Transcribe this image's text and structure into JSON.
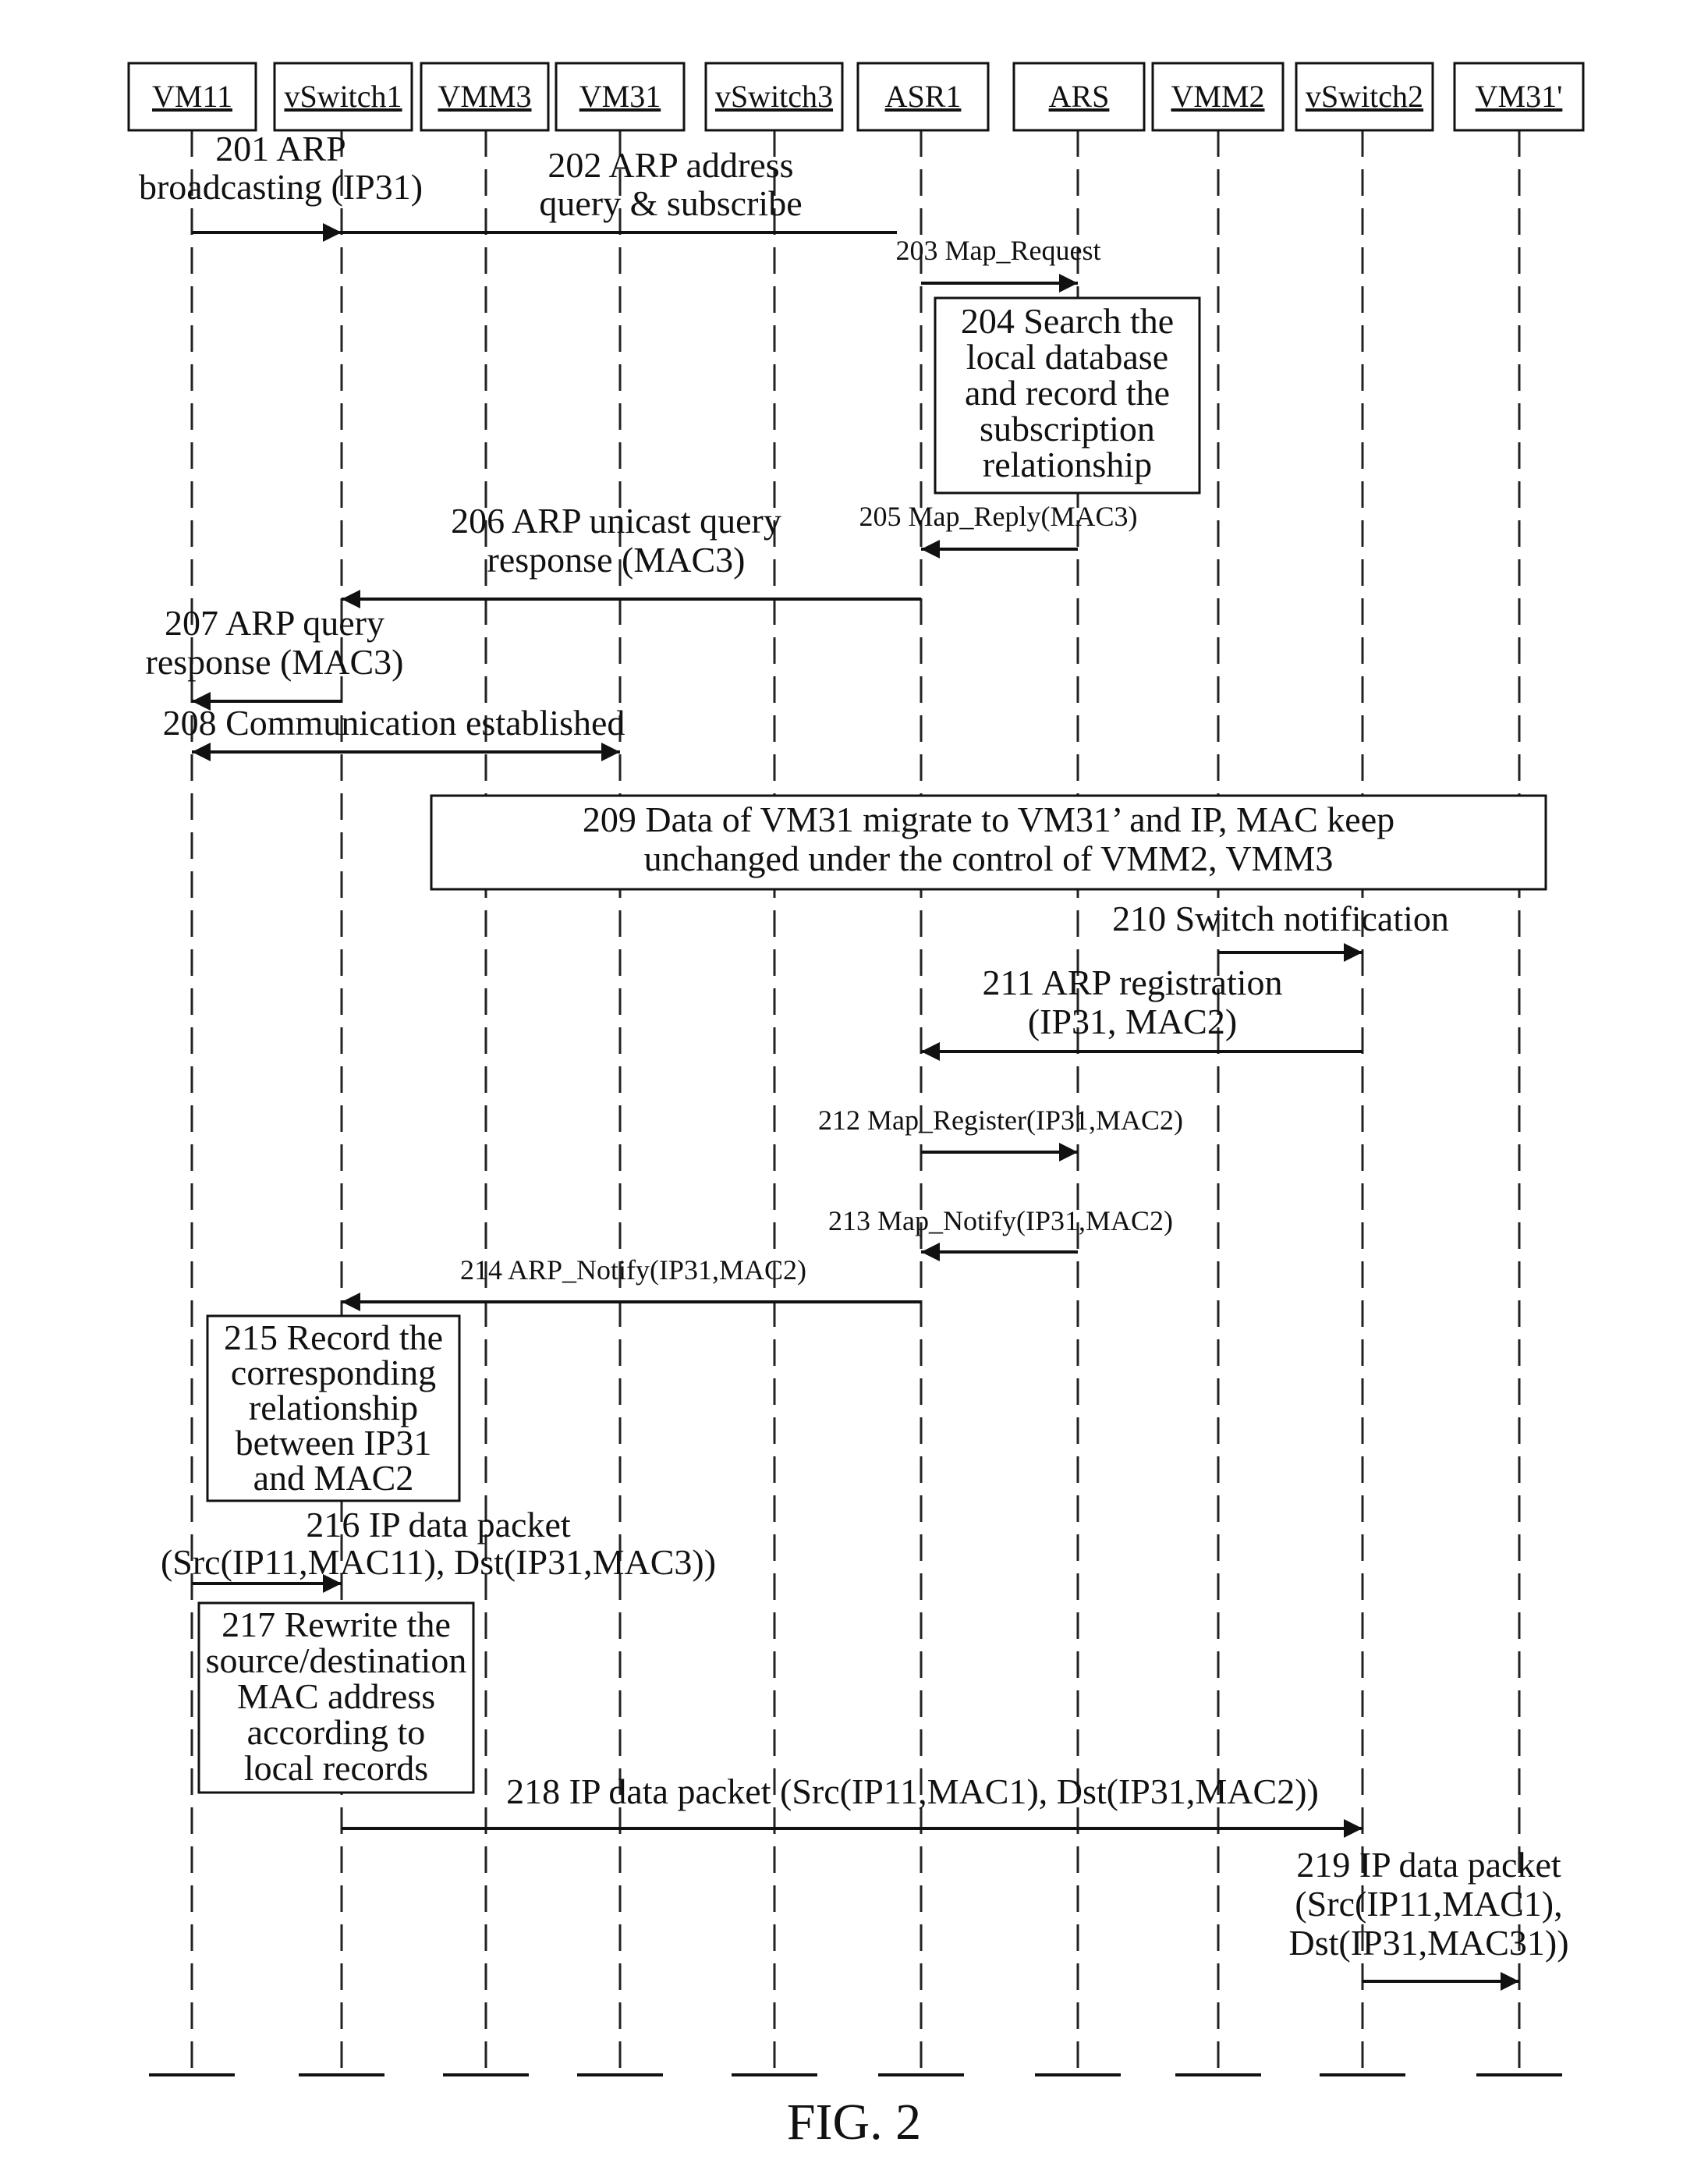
{
  "figure": {
    "caption": "FIG. 2",
    "actors": [
      {
        "id": "VM11",
        "label": "VM11"
      },
      {
        "id": "vSwitch1",
        "label": "vSwitch1"
      },
      {
        "id": "VMM3",
        "label": "VMM3"
      },
      {
        "id": "VM31",
        "label": "VM31"
      },
      {
        "id": "vSwitch3",
        "label": "vSwitch3"
      },
      {
        "id": "ASR1",
        "label": "ASR1"
      },
      {
        "id": "ARS",
        "label": "ARS"
      },
      {
        "id": "VMM2",
        "label": "VMM2"
      },
      {
        "id": "vSwitch2",
        "label": "vSwitch2"
      },
      {
        "id": "VM31p",
        "label": "VM31'"
      }
    ],
    "messages": [
      {
        "step": "201",
        "from": "VM11",
        "to": "vSwitch1",
        "lines": [
          "201 ARP",
          "broadcasting (IP31)"
        ]
      },
      {
        "step": "202",
        "from": "vSwitch1",
        "to": "ASR1",
        "lines": [
          "202 ARP address",
          "query & subscribe"
        ]
      },
      {
        "step": "203",
        "from": "ASR1",
        "to": "ARS",
        "lines": [
          "203 Map_Request"
        ]
      },
      {
        "step": "205",
        "from": "ARS",
        "to": "ASR1",
        "lines": [
          "205 Map_Reply(MAC3)"
        ]
      },
      {
        "step": "206",
        "from": "ASR1",
        "to": "vSwitch1",
        "lines": [
          "206 ARP unicast query",
          "response (MAC3)"
        ]
      },
      {
        "step": "207",
        "from": "vSwitch1",
        "to": "VM11",
        "lines": [
          "207 ARP query",
          "response (MAC3)"
        ]
      },
      {
        "step": "208",
        "from": "VM11",
        "to": "VM31",
        "bidirectional": true,
        "lines": [
          "208 Communication established"
        ]
      },
      {
        "step": "210",
        "from": "VMM2",
        "to": "vSwitch2",
        "lines": [
          "210 Switch notification"
        ]
      },
      {
        "step": "211",
        "from": "vSwitch2",
        "to": "ASR1",
        "lines": [
          "211 ARP registration",
          "(IP31, MAC2)"
        ]
      },
      {
        "step": "212",
        "from": "ASR1",
        "to": "ARS",
        "lines": [
          "212 Map_Register(IP31,MAC2)"
        ]
      },
      {
        "step": "213",
        "from": "ARS",
        "to": "ASR1",
        "lines": [
          "213 Map_Notify(IP31,MAC2)"
        ]
      },
      {
        "step": "214",
        "from": "ASR1",
        "to": "vSwitch1",
        "lines": [
          "214 ARP_Notify(IP31,MAC2)"
        ]
      },
      {
        "step": "216",
        "from": "VM11",
        "to": "vSwitch1",
        "lines": [
          "216 IP data packet",
          "(Src(IP11,MAC11), Dst(IP31,MAC3))"
        ]
      },
      {
        "step": "218",
        "from": "vSwitch1",
        "to": "vSwitch2",
        "lines": [
          "218 IP data packet (Src(IP11,MAC1), Dst(IP31,MAC2))"
        ]
      },
      {
        "step": "219",
        "from": "vSwitch2",
        "to": "VM31p",
        "lines": [
          "219 IP data packet",
          "(Src(IP11,MAC1),",
          "Dst(IP31,MAC31))"
        ]
      }
    ],
    "notes": [
      {
        "step": "204",
        "lines": [
          "204 Search the",
          "local database",
          "and record the",
          "subscription",
          "relationship"
        ]
      },
      {
        "step": "209",
        "lines": [
          "209 Data of VM31 migrate to VM31’ and IP, MAC keep",
          "unchanged under the control of VMM2, VMM3"
        ]
      },
      {
        "step": "215",
        "lines": [
          "215 Record the",
          "corresponding",
          "relationship",
          "between IP31",
          "and MAC2"
        ]
      },
      {
        "step": "217",
        "lines": [
          "217 Rewrite the",
          "source/destination",
          "MAC address",
          "according to",
          "local records"
        ]
      }
    ]
  }
}
